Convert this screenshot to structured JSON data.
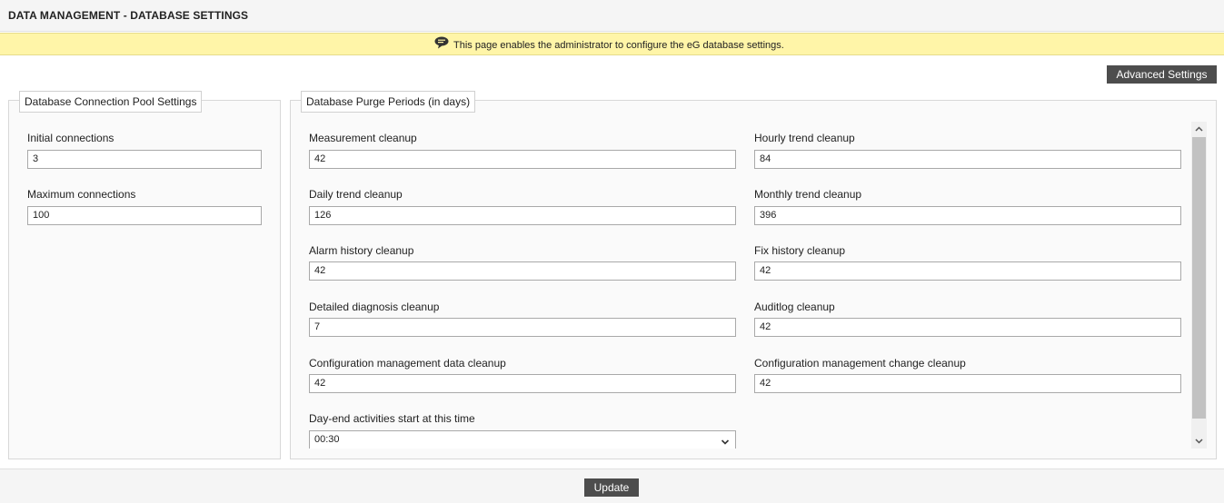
{
  "header": {
    "title": "DATA MANAGEMENT - DATABASE SETTINGS"
  },
  "info": {
    "icon": "chat-bubble-icon",
    "text": "This page enables the administrator to configure the eG database settings."
  },
  "advanced_settings_label": "Advanced Settings",
  "pool": {
    "legend": "Database Connection Pool Settings",
    "initial_label": "Initial connections",
    "initial_value": "3",
    "max_label": "Maximum connections",
    "max_value": "100"
  },
  "purge": {
    "legend": "Database Purge Periods (in days)",
    "measurement_label": "Measurement cleanup",
    "measurement_value": "42",
    "hourly_label": "Hourly trend cleanup",
    "hourly_value": "84",
    "daily_label": "Daily trend cleanup",
    "daily_value": "126",
    "monthly_label": "Monthly trend cleanup",
    "monthly_value": "396",
    "alarm_label": "Alarm history cleanup",
    "alarm_value": "42",
    "fix_label": "Fix history cleanup",
    "fix_value": "42",
    "dd_label": "Detailed diagnosis cleanup",
    "dd_value": "7",
    "audit_label": "Auditlog cleanup",
    "audit_value": "42",
    "cm_data_label": "Configuration management data cleanup",
    "cm_data_value": "42",
    "cm_change_label": "Configuration management change cleanup",
    "cm_change_value": "42",
    "dayend_label": "Day-end activities start at this time",
    "dayend_value": "00:30"
  },
  "footer": {
    "update_label": "Update"
  },
  "colors": {
    "info_background": "#fff5a8",
    "button_background": "#4d4d4d",
    "header_background": "#f5f5f5"
  }
}
